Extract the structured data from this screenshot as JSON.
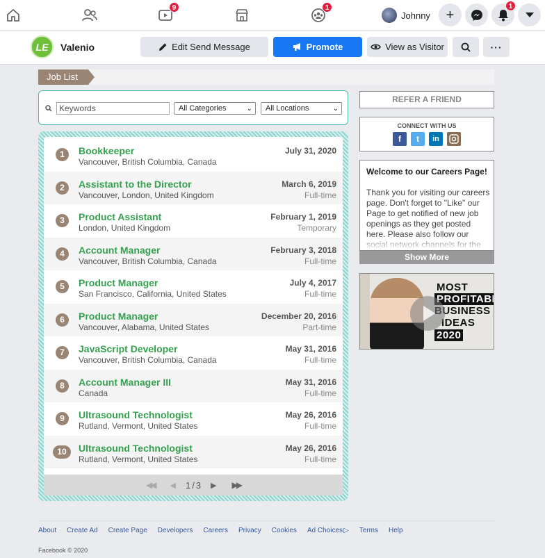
{
  "topnav": {
    "badges": {
      "watch": "9",
      "groups": "1",
      "notifications": "1"
    },
    "user_name": "Johnny"
  },
  "page": {
    "name": "Valenio",
    "logo_text": "LE",
    "buttons": {
      "edit": "Edit Send Message",
      "promote": "Promote",
      "visitor": "View as Visitor"
    }
  },
  "joblist": {
    "tab_label": "Job List",
    "search_placeholder": "Keywords",
    "categories_value": "All Categories",
    "locations_value": "All Locations",
    "jobs": [
      {
        "num": "1",
        "title": "Bookkeeper",
        "location": "Vancouver, British Columbia, Canada",
        "date": "July 31, 2020",
        "type": ""
      },
      {
        "num": "2",
        "title": "Assistant to the Director",
        "location": "Vancouver, London, United Kingdom",
        "date": "March 6, 2019",
        "type": "Full-time"
      },
      {
        "num": "3",
        "title": "Product Assistant",
        "location": "London, United Kingdom",
        "date": "February 1, 2019",
        "type": "Temporary"
      },
      {
        "num": "4",
        "title": "Account Manager",
        "location": "Vancouver, British Columbia, Canada",
        "date": "February 3, 2018",
        "type": "Full-time"
      },
      {
        "num": "5",
        "title": "Product Manager",
        "location": "San Francisco, California, United States",
        "date": "July 4, 2017",
        "type": "Full-time"
      },
      {
        "num": "6",
        "title": "Product Manager",
        "location": "Vancouver, Alabama, United States",
        "date": "December 20, 2016",
        "type": "Part-time"
      },
      {
        "num": "7",
        "title": "JavaScript Developer",
        "location": "Vancouver, British Columbia, Canada",
        "date": "May 31, 2016",
        "type": "Full-time"
      },
      {
        "num": "8",
        "title": "Account Manager III",
        "location": "Canada",
        "date": "May 31, 2016",
        "type": "Full-time"
      },
      {
        "num": "9",
        "title": "Ultrasound Technologist",
        "location": "Rutland, Vermont, United States",
        "date": "May 26, 2016",
        "type": "Full-time"
      },
      {
        "num": "10",
        "title": "Ultrasound Technologist",
        "location": "Rutland, Vermont, United States",
        "date": "May 26, 2016",
        "type": "Full-time"
      }
    ],
    "pager": {
      "current": "1",
      "total": "3"
    }
  },
  "sidebar": {
    "refer": "REFER A FRIEND",
    "connect_title": "CONNECT WITH US",
    "welcome_title": "Welcome to our Careers Page!",
    "welcome_body": "Thank you for visiting our careers page. Don't forget to \"Like\" our Page to get notified of new job openings as they get posted here. Please also follow our social network channels for the latest",
    "show_more": "Show More",
    "video_lines": [
      "MOST",
      "PROFITABLE",
      "BUSINESS",
      "IDEAS",
      "2020"
    ]
  },
  "footer": {
    "links": [
      "About",
      "Create Ad",
      "Create Page",
      "Developers",
      "Careers",
      "Privacy",
      "Cookies",
      "Ad Choices",
      "Terms",
      "Help"
    ],
    "copyright": "Facebook © 2020"
  }
}
